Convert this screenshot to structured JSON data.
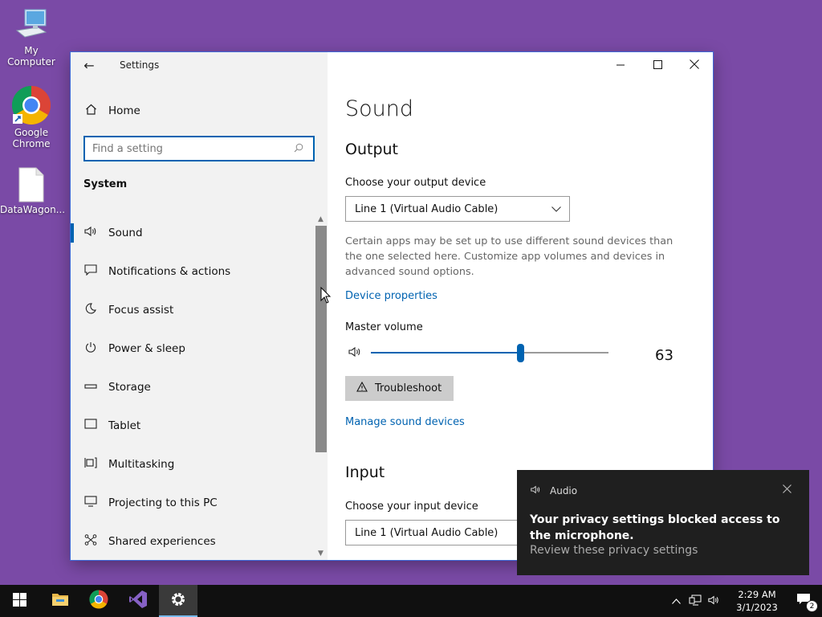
{
  "desktop": {
    "icons": [
      {
        "label": "My Computer"
      },
      {
        "label": "Google Chrome"
      },
      {
        "label": "DataWagon..."
      }
    ]
  },
  "window": {
    "title": "Settings",
    "controls": {
      "minimize": "minimize-icon",
      "maximize": "maximize-icon",
      "close": "close-icon"
    }
  },
  "sidebar": {
    "home": "Home",
    "search_placeholder": "Find a setting",
    "section": "System",
    "items": [
      {
        "label": "Sound",
        "icon": "speaker-icon",
        "active": true
      },
      {
        "label": "Notifications & actions",
        "icon": "notification-icon"
      },
      {
        "label": "Focus assist",
        "icon": "moon-icon"
      },
      {
        "label": "Power & sleep",
        "icon": "power-icon"
      },
      {
        "label": "Storage",
        "icon": "storage-icon"
      },
      {
        "label": "Tablet",
        "icon": "tablet-icon"
      },
      {
        "label": "Multitasking",
        "icon": "multitasking-icon"
      },
      {
        "label": "Projecting to this PC",
        "icon": "projecting-icon"
      },
      {
        "label": "Shared experiences",
        "icon": "shared-icon"
      }
    ]
  },
  "main": {
    "title": "Sound",
    "output": {
      "heading": "Output",
      "choose_label": "Choose your output device",
      "device": "Line 1 (Virtual Audio Cable)",
      "description": "Certain apps may be set up to use different sound devices than the one selected here. Customize app volumes and devices in advanced sound options.",
      "device_properties": "Device properties",
      "master_volume_label": "Master volume",
      "volume": 63,
      "troubleshoot": "Troubleshoot",
      "manage_devices": "Manage sound devices"
    },
    "input": {
      "heading": "Input",
      "choose_label": "Choose your input device",
      "device": "Line 1 (Virtual Audio Cable)"
    }
  },
  "toast": {
    "app": "Audio",
    "message": "Your privacy settings blocked access to the microphone.",
    "action": "Review these privacy settings"
  },
  "taskbar": {
    "time": "2:29 AM",
    "date": "3/1/2023",
    "notification_count": "2",
    "accent": "#76b9ed"
  },
  "colors": {
    "accent": "#0063b1",
    "desktop": "#7a4aa6"
  }
}
